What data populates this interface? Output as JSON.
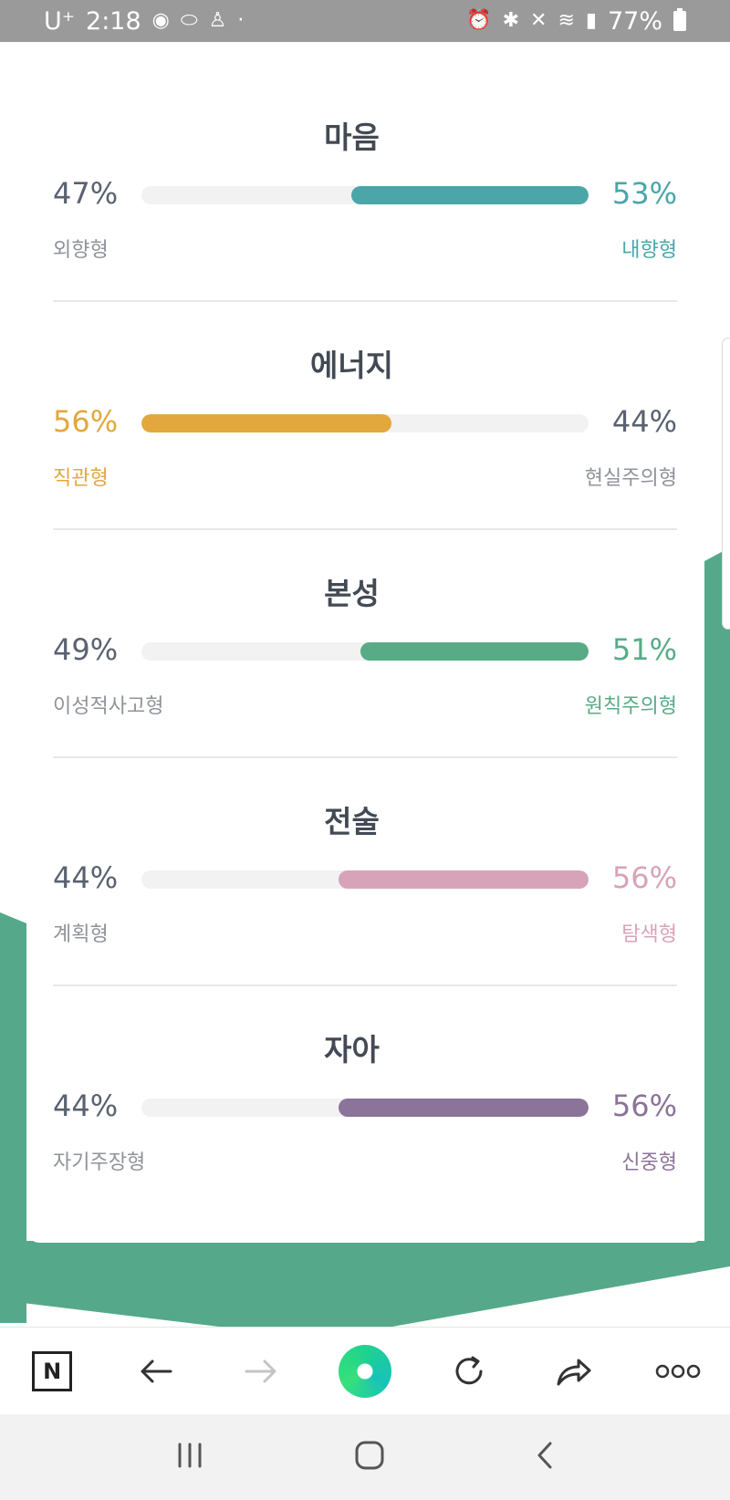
{
  "status_bar": {
    "carrier": "U⁺",
    "time": "2:18",
    "battery": "77%"
  },
  "colors": {
    "green_bg": "#55a98a",
    "mind": "#4aa6a9",
    "energy": "#e2a83d",
    "nature": "#58ab86",
    "tactics": "#d7a3b8",
    "identity": "#8b7399",
    "neutral_text": "#5a6170",
    "muted_label": "#8f939a"
  },
  "sections": [
    {
      "title": "마음",
      "left_pct": "47%",
      "right_pct": "53%",
      "left_label": "외향형",
      "right_label": "내향형",
      "dominant": "right",
      "fill": 0.53,
      "color": "#4aa6a9"
    },
    {
      "title": "에너지",
      "left_pct": "56%",
      "right_pct": "44%",
      "left_label": "직관형",
      "right_label": "현실주의형",
      "dominant": "left",
      "fill": 0.56,
      "color": "#e2a83d"
    },
    {
      "title": "본성",
      "left_pct": "49%",
      "right_pct": "51%",
      "left_label": "이성적사고형",
      "right_label": "원칙주의형",
      "dominant": "right",
      "fill": 0.51,
      "color": "#58ab86"
    },
    {
      "title": "전술",
      "left_pct": "44%",
      "right_pct": "56%",
      "left_label": "계획형",
      "right_label": "탐색형",
      "dominant": "right",
      "fill": 0.56,
      "color": "#d7a3b8"
    },
    {
      "title": "자아",
      "left_pct": "44%",
      "right_pct": "56%",
      "left_label": "자기주장형",
      "right_label": "신중형",
      "dominant": "right",
      "fill": 0.56,
      "color": "#8b7399"
    }
  ],
  "toolbar": {
    "home_label": "N",
    "icons": [
      "naver-home-icon",
      "back-arrow-icon",
      "forward-arrow-icon",
      "green-dot-menu-icon",
      "reload-icon",
      "share-icon",
      "more-icon"
    ]
  },
  "navbar": {
    "icons": [
      "recent-apps-icon",
      "home-icon",
      "back-icon"
    ]
  }
}
